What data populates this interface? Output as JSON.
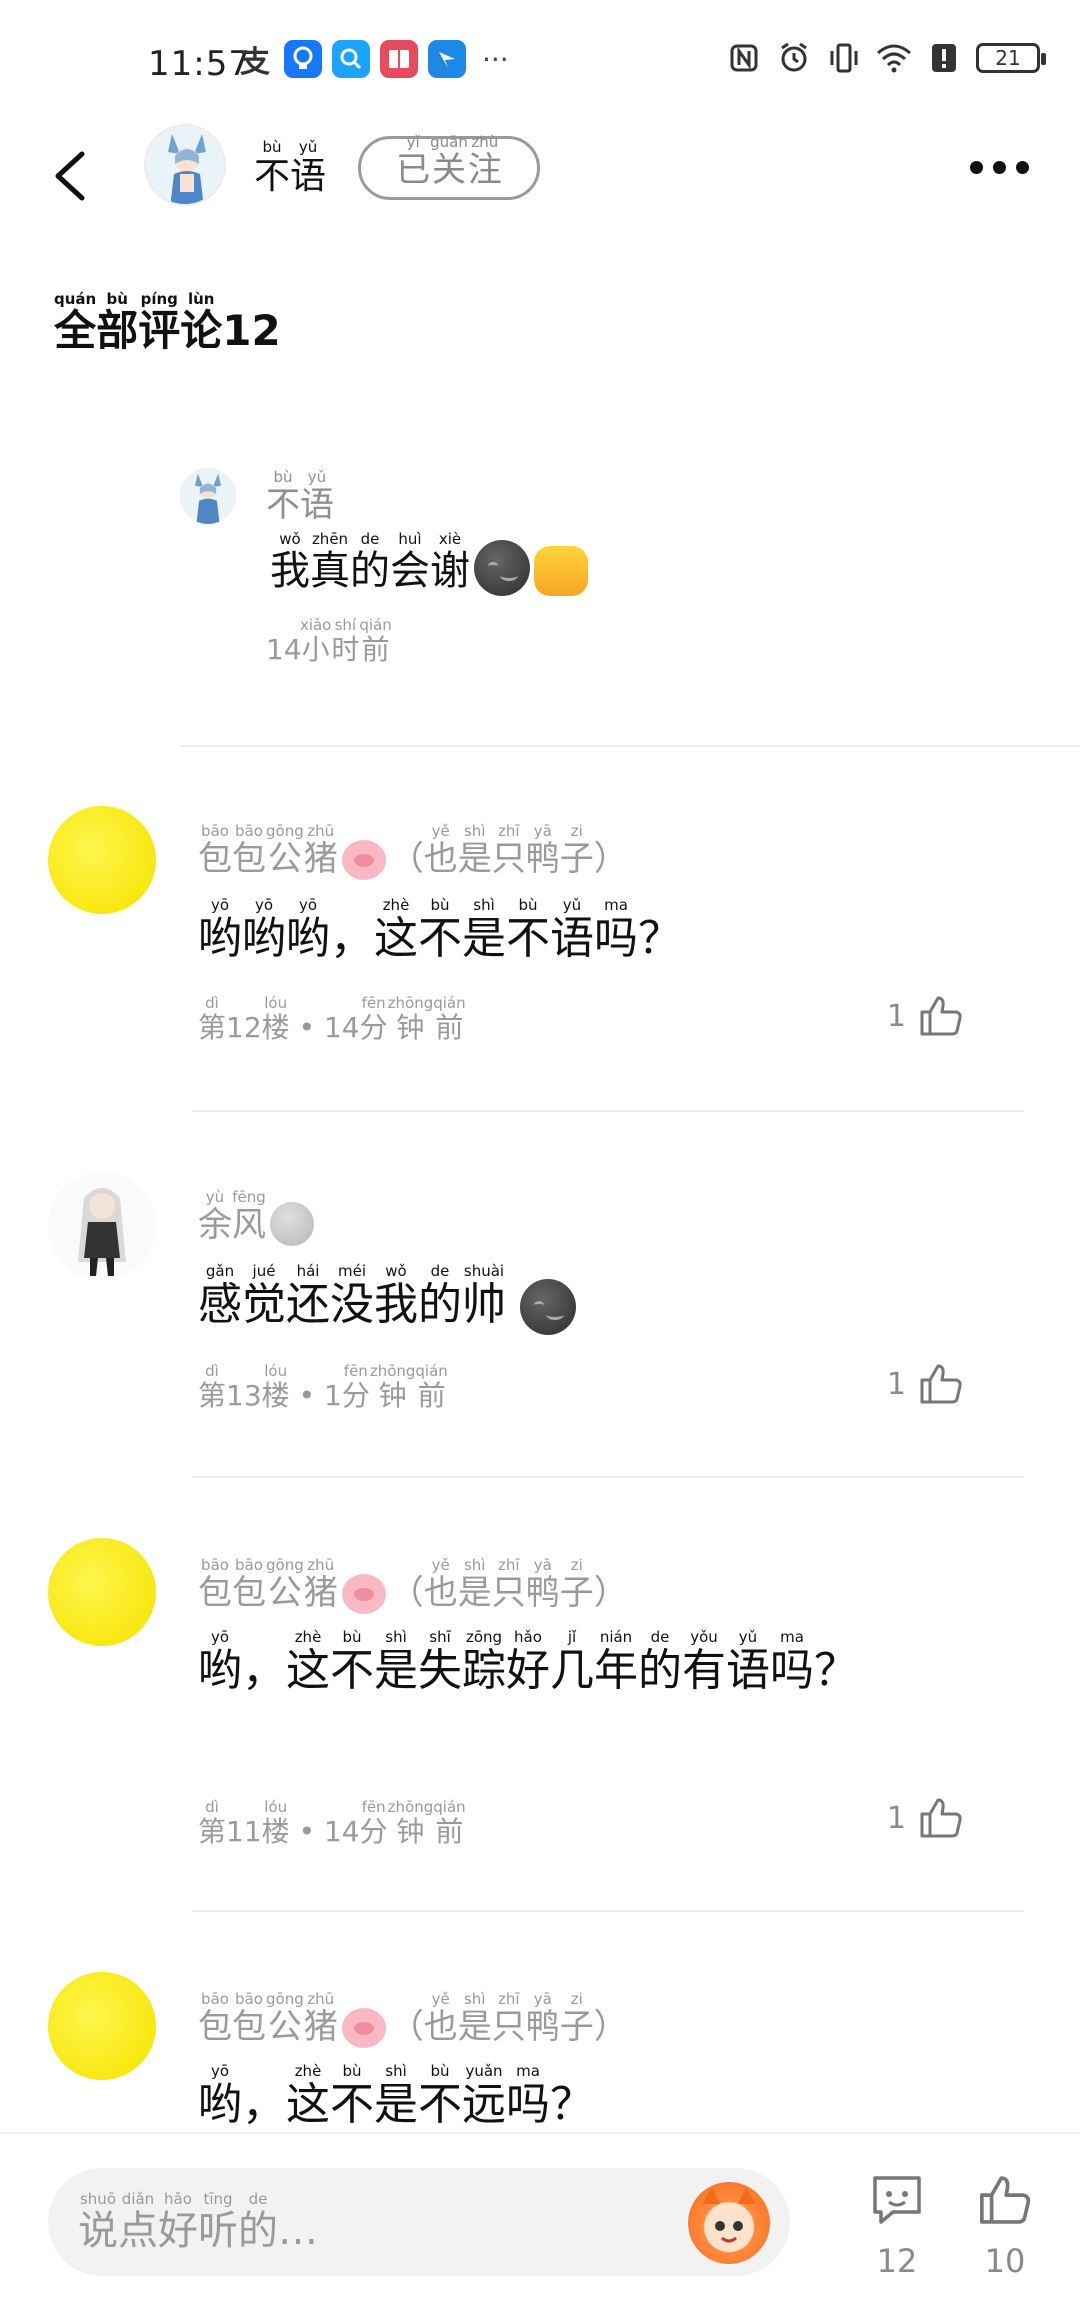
{
  "status_bar": {
    "time": "11:57",
    "app_icons": [
      {
        "name": "alipay-icon",
        "color": "#ffffff",
        "glyph": "支"
      },
      {
        "name": "bulb-app-icon",
        "color": "#1677ff",
        "glyph": "💡"
      },
      {
        "name": "search-app-icon",
        "color": "#1aa3ff",
        "glyph": "Q"
      },
      {
        "name": "book-app-icon",
        "color": "#e84a5f",
        "glyph": "▮"
      },
      {
        "name": "bird-app-icon",
        "color": "#1e88e5",
        "glyph": "➤"
      }
    ],
    "more_dots": "···",
    "battery": "21"
  },
  "header": {
    "user_name": [
      {
        "char": "不",
        "py": "bù"
      },
      {
        "char": "语",
        "py": "yǔ"
      }
    ],
    "follow_label": [
      {
        "char": "已",
        "py": "yǐ"
      },
      {
        "char": "关",
        "py": "guān"
      },
      {
        "char": "注",
        "py": "zhù"
      }
    ]
  },
  "section": {
    "title_chars": [
      {
        "char": "全",
        "py": "quán"
      },
      {
        "char": "部",
        "py": "bù"
      },
      {
        "char": "评",
        "py": "píng"
      },
      {
        "char": "论",
        "py": "lùn"
      }
    ],
    "count": "12"
  },
  "reply": {
    "name": [
      {
        "char": "不",
        "py": "bù"
      },
      {
        "char": "语",
        "py": "yǔ"
      }
    ],
    "text": [
      {
        "char": "我",
        "py": "wǒ"
      },
      {
        "char": "真",
        "py": "zhēn"
      },
      {
        "char": "的",
        "py": "de"
      },
      {
        "char": "会",
        "py": "huì"
      },
      {
        "char": "谢",
        "py": "xiè"
      }
    ],
    "time": [
      {
        "char": "14",
        "py": ""
      },
      {
        "char": "小",
        "py": "xiǎo"
      },
      {
        "char": "时",
        "py": "shí"
      },
      {
        "char": "前",
        "py": "qián"
      }
    ]
  },
  "comments": [
    {
      "name": [
        {
          "char": "包",
          "py": "bāo"
        },
        {
          "char": "包",
          "py": "bāo"
        },
        {
          "char": "公",
          "py": "gōng"
        },
        {
          "char": "猪",
          "py": "zhū"
        }
      ],
      "name_suffix": [
        {
          "char": "（",
          "py": ""
        },
        {
          "char": "也",
          "py": "yě"
        },
        {
          "char": "是",
          "py": "shì"
        },
        {
          "char": "只",
          "py": "zhī"
        },
        {
          "char": "鸭",
          "py": "yā"
        },
        {
          "char": "子",
          "py": "zi"
        },
        {
          "char": "）",
          "py": ""
        }
      ],
      "text": [
        {
          "char": "哟",
          "py": "yō"
        },
        {
          "char": "哟",
          "py": "yō"
        },
        {
          "char": "哟",
          "py": "yō"
        },
        {
          "char": "，",
          "py": ""
        },
        {
          "char": "这",
          "py": "zhè"
        },
        {
          "char": "不",
          "py": "bù"
        },
        {
          "char": "是",
          "py": "shì"
        },
        {
          "char": "不",
          "py": "bù"
        },
        {
          "char": "语",
          "py": "yǔ"
        },
        {
          "char": "吗",
          "py": "ma"
        },
        {
          "char": "？",
          "py": ""
        }
      ],
      "meta": [
        {
          "char": "第",
          "py": "dì"
        },
        {
          "char": "12",
          "py": ""
        },
        {
          "char": "楼",
          "py": "lóu"
        },
        {
          "char": " • 14",
          "py": ""
        },
        {
          "char": "分",
          "py": "fēn"
        },
        {
          "char": "钟",
          "py": "zhōng"
        },
        {
          "char": "前",
          "py": "qián"
        }
      ],
      "likes": "1"
    },
    {
      "name": [
        {
          "char": "余",
          "py": "yù"
        },
        {
          "char": "风",
          "py": "fēng"
        }
      ],
      "name_suffix": [],
      "text": [
        {
          "char": "感",
          "py": "gǎn"
        },
        {
          "char": "觉",
          "py": "jué"
        },
        {
          "char": "还",
          "py": "hái"
        },
        {
          "char": "没",
          "py": "méi"
        },
        {
          "char": "我",
          "py": "wǒ"
        },
        {
          "char": "的",
          "py": "de"
        },
        {
          "char": "帅",
          "py": "shuài"
        }
      ],
      "meta": [
        {
          "char": "第",
          "py": "dì"
        },
        {
          "char": "13",
          "py": ""
        },
        {
          "char": "楼",
          "py": "lóu"
        },
        {
          "char": " • 1",
          "py": ""
        },
        {
          "char": "分",
          "py": "fēn"
        },
        {
          "char": "钟",
          "py": "zhōng"
        },
        {
          "char": "前",
          "py": "qián"
        }
      ],
      "likes": "1"
    },
    {
      "name": [
        {
          "char": "包",
          "py": "bāo"
        },
        {
          "char": "包",
          "py": "bāo"
        },
        {
          "char": "公",
          "py": "gōng"
        },
        {
          "char": "猪",
          "py": "zhū"
        }
      ],
      "name_suffix": [
        {
          "char": "（",
          "py": ""
        },
        {
          "char": "也",
          "py": "yě"
        },
        {
          "char": "是",
          "py": "shì"
        },
        {
          "char": "只",
          "py": "zhī"
        },
        {
          "char": "鸭",
          "py": "yā"
        },
        {
          "char": "子",
          "py": "zi"
        },
        {
          "char": "）",
          "py": ""
        }
      ],
      "text": [
        {
          "char": "哟",
          "py": "yō"
        },
        {
          "char": "，",
          "py": ""
        },
        {
          "char": "这",
          "py": "zhè"
        },
        {
          "char": "不",
          "py": "bù"
        },
        {
          "char": "是",
          "py": "shì"
        },
        {
          "char": "失",
          "py": "shī"
        },
        {
          "char": "踪",
          "py": "zōng"
        },
        {
          "char": "好",
          "py": "hǎo"
        },
        {
          "char": "几",
          "py": "jǐ"
        },
        {
          "char": "年",
          "py": "nián"
        },
        {
          "char": "的",
          "py": "de"
        },
        {
          "char": "有",
          "py": "yǒu"
        },
        {
          "char": "语",
          "py": "yǔ"
        },
        {
          "char": "吗",
          "py": "ma"
        },
        {
          "char": "？",
          "py": ""
        }
      ],
      "meta": [
        {
          "char": "第",
          "py": "dì"
        },
        {
          "char": "11",
          "py": ""
        },
        {
          "char": "楼",
          "py": "lóu"
        },
        {
          "char": " • 14",
          "py": ""
        },
        {
          "char": "分",
          "py": "fēn"
        },
        {
          "char": "钟",
          "py": "zhōng"
        },
        {
          "char": "前",
          "py": "qián"
        }
      ],
      "likes": "1"
    },
    {
      "name": [
        {
          "char": "包",
          "py": "bāo"
        },
        {
          "char": "包",
          "py": "bāo"
        },
        {
          "char": "公",
          "py": "gōng"
        },
        {
          "char": "猪",
          "py": "zhū"
        }
      ],
      "name_suffix": [
        {
          "char": "（",
          "py": ""
        },
        {
          "char": "也",
          "py": "yě"
        },
        {
          "char": "是",
          "py": "shì"
        },
        {
          "char": "只",
          "py": "zhī"
        },
        {
          "char": "鸭",
          "py": "yā"
        },
        {
          "char": "子",
          "py": "zi"
        },
        {
          "char": "）",
          "py": ""
        }
      ],
      "text": [
        {
          "char": "哟",
          "py": "yō"
        },
        {
          "char": "，",
          "py": ""
        },
        {
          "char": "这",
          "py": "zhè"
        },
        {
          "char": "不",
          "py": "bù"
        },
        {
          "char": "是",
          "py": "shì"
        },
        {
          "char": "不",
          "py": "bù"
        },
        {
          "char": "远",
          "py": "yuǎn"
        },
        {
          "char": "吗",
          "py": "ma"
        },
        {
          "char": "？",
          "py": ""
        }
      ],
      "meta": [],
      "likes": ""
    }
  ],
  "bottom_bar": {
    "placeholder": [
      {
        "char": "说",
        "py": "shuō"
      },
      {
        "char": "点",
        "py": "diǎn"
      },
      {
        "char": "好",
        "py": "hǎo"
      },
      {
        "char": "听",
        "py": "tīng"
      },
      {
        "char": "的",
        "py": "de"
      },
      {
        "char": "…",
        "py": ""
      }
    ],
    "comment_count": "12",
    "like_count": "10"
  }
}
